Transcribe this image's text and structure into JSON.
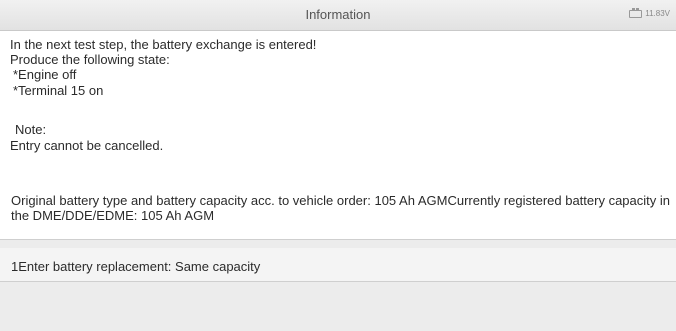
{
  "header": {
    "title": "Information",
    "voltage": "11.83V"
  },
  "message": {
    "line1": "In the next test step, the battery exchange is entered!",
    "line2": "Produce the following state:",
    "line3": "*Engine off",
    "line4": "*Terminal 15 on",
    "note_label": "Note:",
    "note_text": "Entry cannot be cancelled.",
    "battery_info": "Original battery type and battery capacity acc. to vehicle order: 105 Ah AGMCurrently registered battery capacity in the DME/DDE/EDME: 105 Ah AGM"
  },
  "options": [
    {
      "label": "1Enter battery replacement: Same capacity"
    }
  ]
}
